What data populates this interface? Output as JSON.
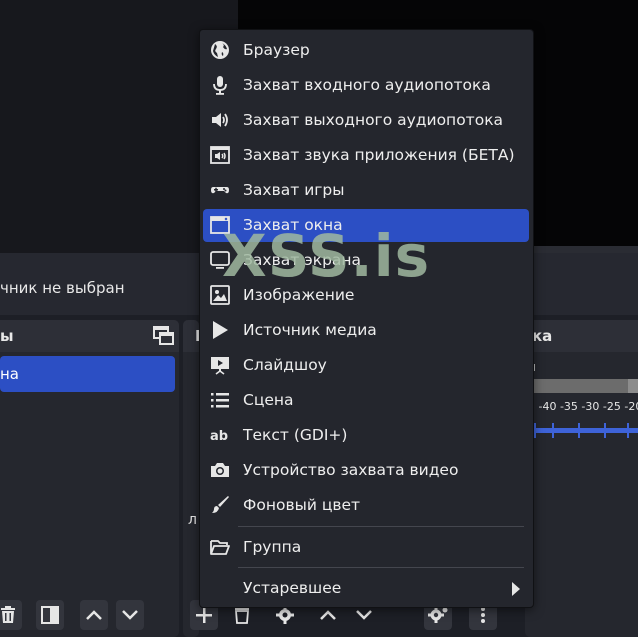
{
  "status": {
    "no_source_text": "чник не выбран"
  },
  "docks": {
    "scenes": {
      "title": "ы",
      "selected_scene": "на"
    },
    "sources": {
      "title": "И",
      "cut_label": "л"
    },
    "mixer": {
      "title": "ка",
      "meter_ticks": "5 -40 -35 -30 -25 -20"
    }
  },
  "context_menu": {
    "items": [
      {
        "label": "Браузер",
        "icon": "globe-icon"
      },
      {
        "label": "Захват входного аудиопотока",
        "icon": "microphone-icon"
      },
      {
        "label": "Захват выходного аудиопотока",
        "icon": "speaker-icon"
      },
      {
        "label": "Захват звука приложения (БЕТА)",
        "icon": "app-audio-icon"
      },
      {
        "label": "Захват игры",
        "icon": "gamepad-icon"
      },
      {
        "label": "Захват окна",
        "icon": "window-icon",
        "highlighted": true
      },
      {
        "label": "Захват экрана",
        "icon": "monitor-icon"
      },
      {
        "label": "Изображение",
        "icon": "image-icon"
      },
      {
        "label": "Источник медиа",
        "icon": "play-icon"
      },
      {
        "label": "Слайдшоу",
        "icon": "slideshow-icon"
      },
      {
        "label": "Сцена",
        "icon": "list-icon"
      },
      {
        "label": "Текст (GDI+)",
        "icon": "text-icon"
      },
      {
        "label": "Устройство захвата видео",
        "icon": "camera-icon"
      },
      {
        "label": "Фоновый цвет",
        "icon": "brush-icon"
      }
    ],
    "group": {
      "label": "Группа",
      "icon": "folder-icon"
    },
    "deprecated": {
      "label": "Устаревшее",
      "icon": "chevron-right-icon"
    }
  },
  "watermark": {
    "text": "XSS.is"
  },
  "colors": {
    "accent": "#2c4fc4",
    "menu_bg": "#24262d",
    "app_bg": "#1d1f26"
  }
}
